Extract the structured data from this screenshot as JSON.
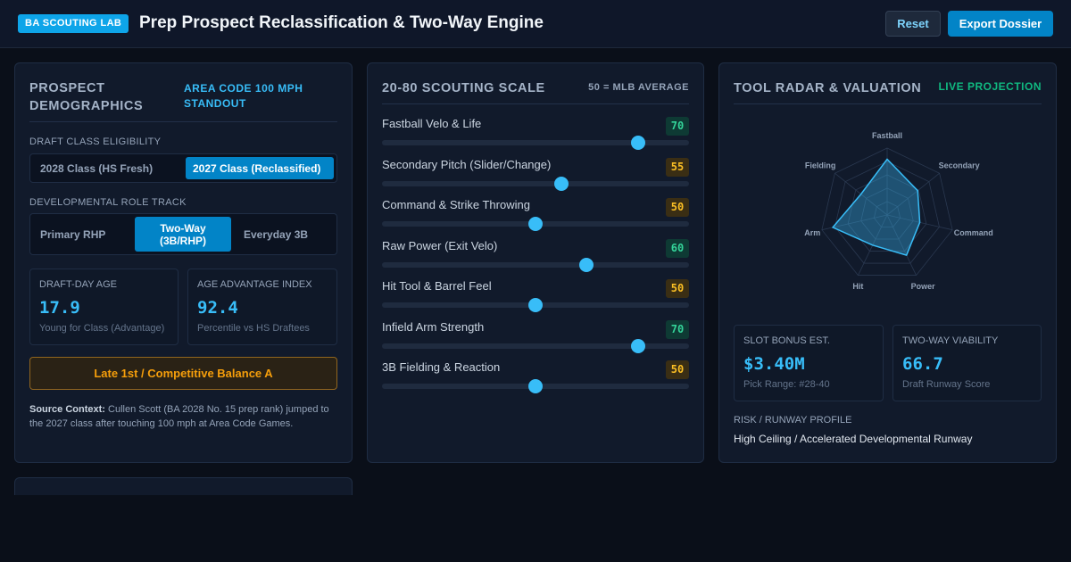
{
  "header": {
    "badge": "BA SCOUTING LAB",
    "title": "Prep Prospect Reclassification & Two-Way Engine",
    "reset_label": "Reset",
    "export_label": "Export Dossier"
  },
  "demographics": {
    "title": "PROSPECT DEMOGRAPHICS",
    "tag": "AREA CODE 100 MPH STANDOUT",
    "eligibility_label": "DRAFT CLASS ELIGIBILITY",
    "eligibility_options": [
      "2028 Class (HS Fresh)",
      "2027 Class (Reclassified)"
    ],
    "eligibility_selected": 1,
    "role_label": "DEVELOPMENTAL ROLE TRACK",
    "role_options": [
      "Primary RHP",
      "Two-Way (3B/RHP)",
      "Everyday 3B"
    ],
    "role_selected": 1,
    "age": {
      "label": "DRAFT-DAY AGE",
      "value": "17.9",
      "sub": "Young for Class (Advantage)"
    },
    "advantage": {
      "label": "AGE ADVANTAGE INDEX",
      "value": "92.4",
      "sub": "Percentile vs HS Draftees"
    },
    "balance_label": "Late 1st / Competitive Balance A",
    "source_label": "Source Context:",
    "source_text": "Cullen Scott (BA 2028 No. 15 prep rank) jumped to the 2027 class after touching 100 mph at Area Code Games."
  },
  "scale": {
    "title": "20-80 SCOUTING SCALE",
    "tag": "50 = MLB AVERAGE",
    "min": 20,
    "max": 80,
    "tools": [
      {
        "name": "Fastball Velo & Life",
        "grade": 70
      },
      {
        "name": "Secondary Pitch (Slider/Change)",
        "grade": 55
      },
      {
        "name": "Command & Strike Throwing",
        "grade": 50
      },
      {
        "name": "Raw Power (Exit Velo)",
        "grade": 60
      },
      {
        "name": "Hit Tool & Barrel Feel",
        "grade": 50
      },
      {
        "name": "Infield Arm Strength",
        "grade": 70
      },
      {
        "name": "3B Fielding & Reaction",
        "grade": 50
      }
    ],
    "colors": {
      "plus": "#34d399",
      "avg": "#fbbf24"
    }
  },
  "radar": {
    "title": "TOOL RADAR & VALUATION",
    "tag": "LIVE PROJECTION",
    "axes": [
      "Fastball",
      "Secondary",
      "Command",
      "Power",
      "Hit",
      "Arm",
      "Fielding"
    ],
    "values": [
      70,
      55,
      50,
      60,
      50,
      70,
      50
    ],
    "min": 20,
    "max": 80,
    "color": "#38bdf8",
    "slot": {
      "label": "SLOT BONUS EST.",
      "value": "$3.40M",
      "sub": "Pick Range: #28-40"
    },
    "viability": {
      "label": "TWO-WAY VIABILITY",
      "value": "66.7",
      "sub": "Draft Runway Score"
    },
    "risk_label": "RISK / RUNWAY PROFILE",
    "risk_value": "High Ceiling / Accelerated Developmental Runway"
  }
}
